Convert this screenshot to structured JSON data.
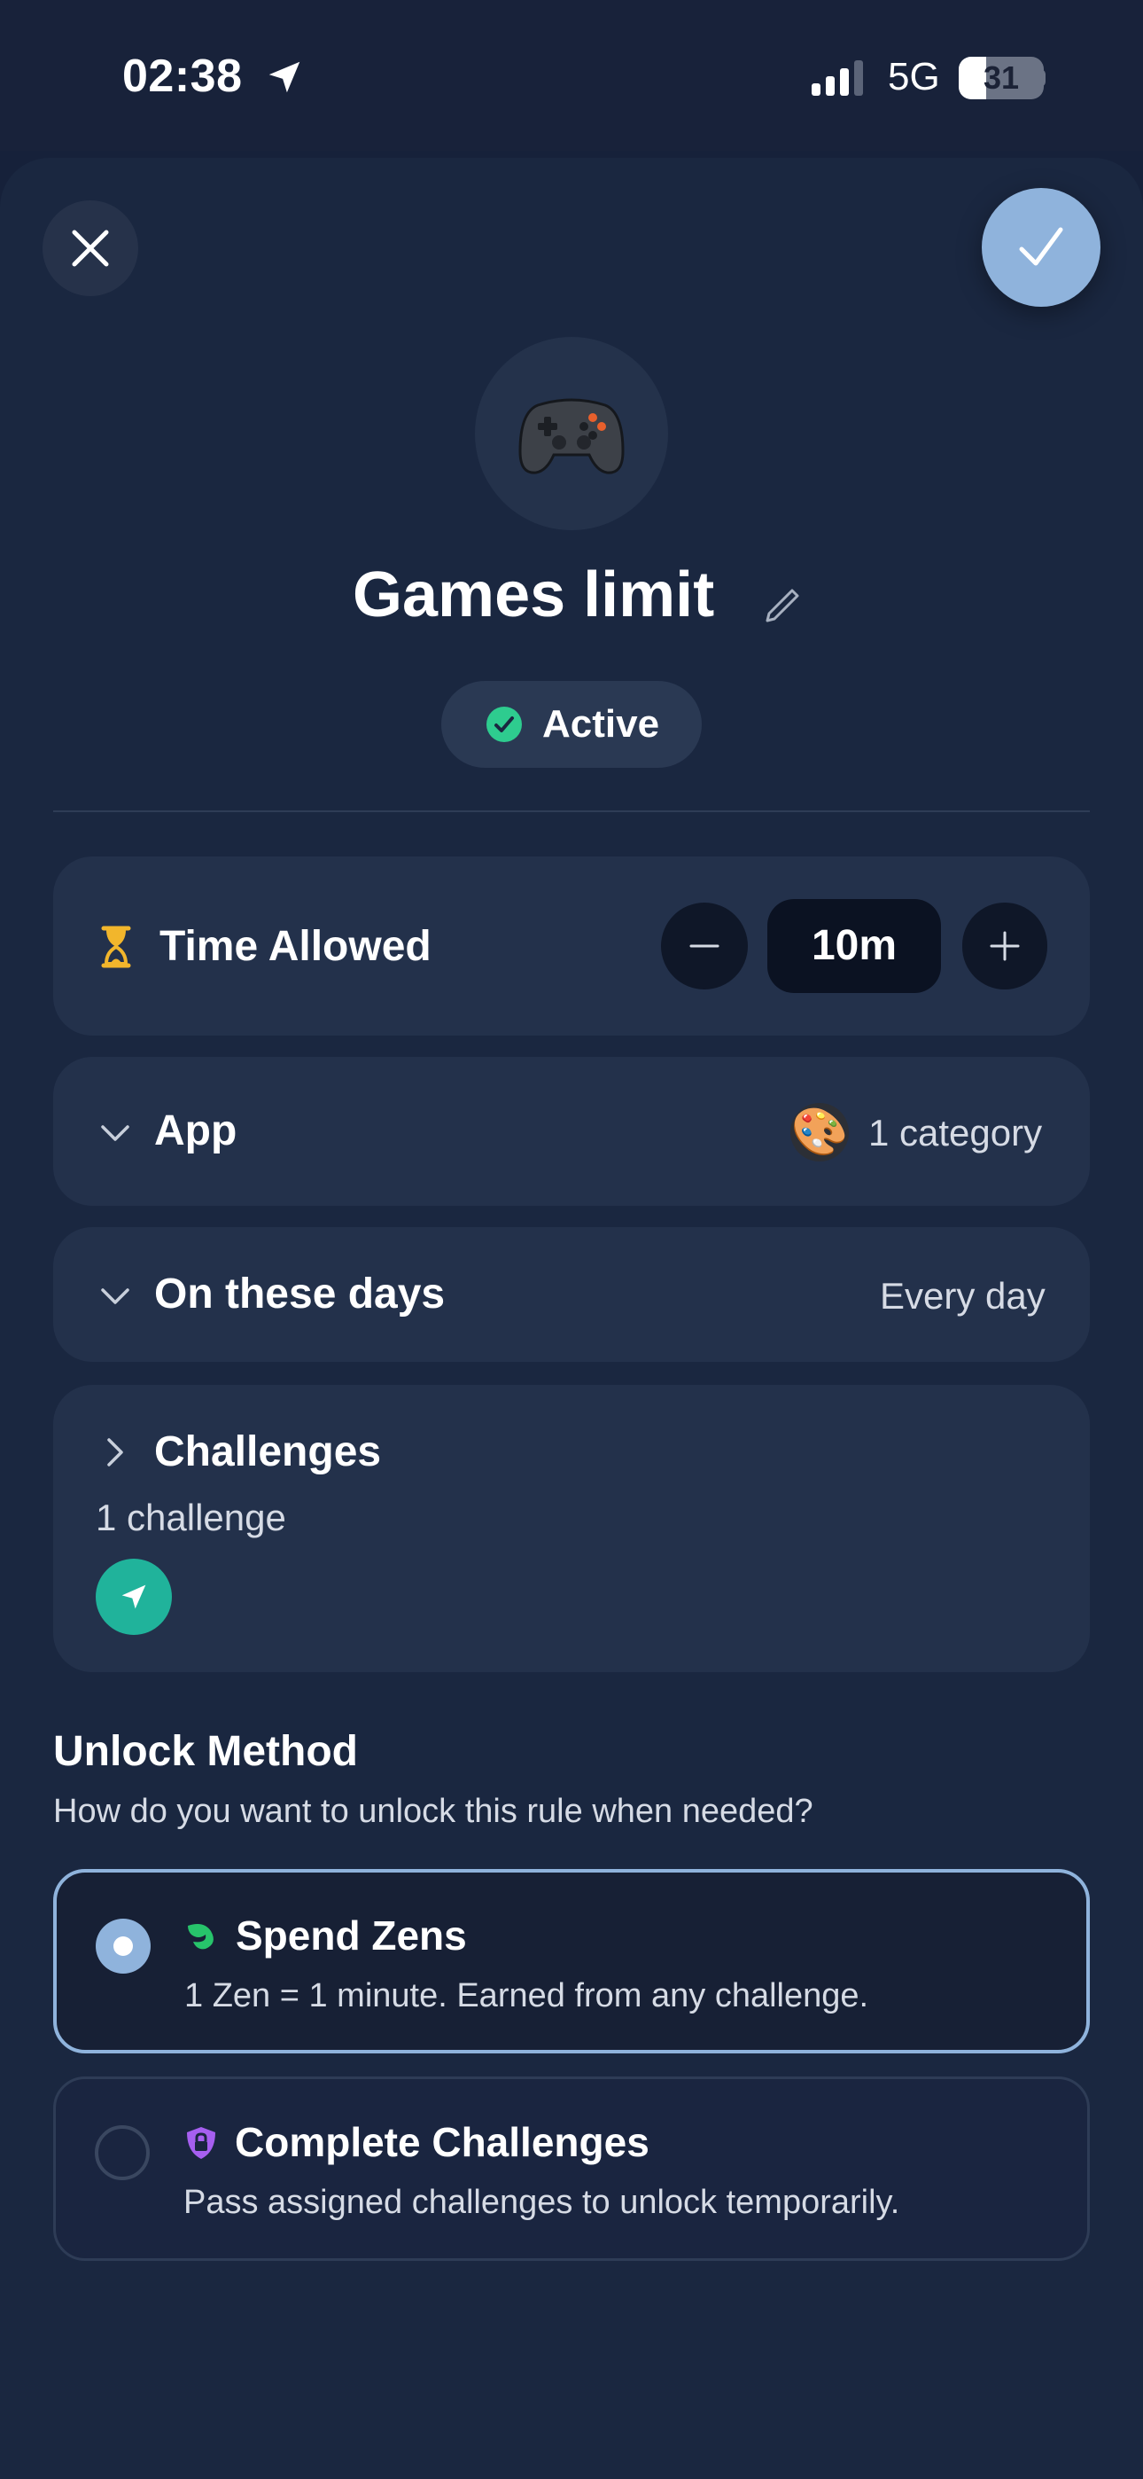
{
  "status_bar": {
    "time": "02:38",
    "network": "5G",
    "battery_level": "31",
    "location_icon": "location-arrow-icon",
    "signal_icon": "cellular-signal-icon"
  },
  "header": {
    "close_icon": "close-icon",
    "confirm_icon": "checkmark-icon",
    "category_emoji": "🎮",
    "title": "Games limit",
    "edit_icon": "pencil-icon",
    "status": "Active"
  },
  "time_allowed": {
    "label": "Time Allowed",
    "value": "10m",
    "icon": "hourglass-icon"
  },
  "app": {
    "label": "App",
    "emoji": "🎨",
    "value": "1 category"
  },
  "days": {
    "label": "On these days",
    "value": "Every day"
  },
  "challenges": {
    "label": "Challenges",
    "count": "1 challenge",
    "badge_icon": "location-arrow-icon"
  },
  "unlock": {
    "title": "Unlock Method",
    "subtitle": "How do you want to unlock this rule when needed?",
    "options": [
      {
        "title": "Spend Zens",
        "description": "1 Zen = 1 minute. Earned from any challenge.",
        "selected": true,
        "icon": "leaf-icon"
      },
      {
        "title": "Complete Challenges",
        "description": "Pass assigned challenges to unlock temporarily.",
        "selected": false,
        "icon": "shield-lock-icon"
      }
    ]
  },
  "colors": {
    "background": "#16213a",
    "card": "#23314b",
    "accent": "#8fb3dc",
    "active_green": "#2ecc8f",
    "challenge_teal": "#20b39b",
    "hourglass_yellow": "#f2b62c",
    "zen_green": "#27c46b",
    "challenge_purple": "#a65ff0"
  }
}
